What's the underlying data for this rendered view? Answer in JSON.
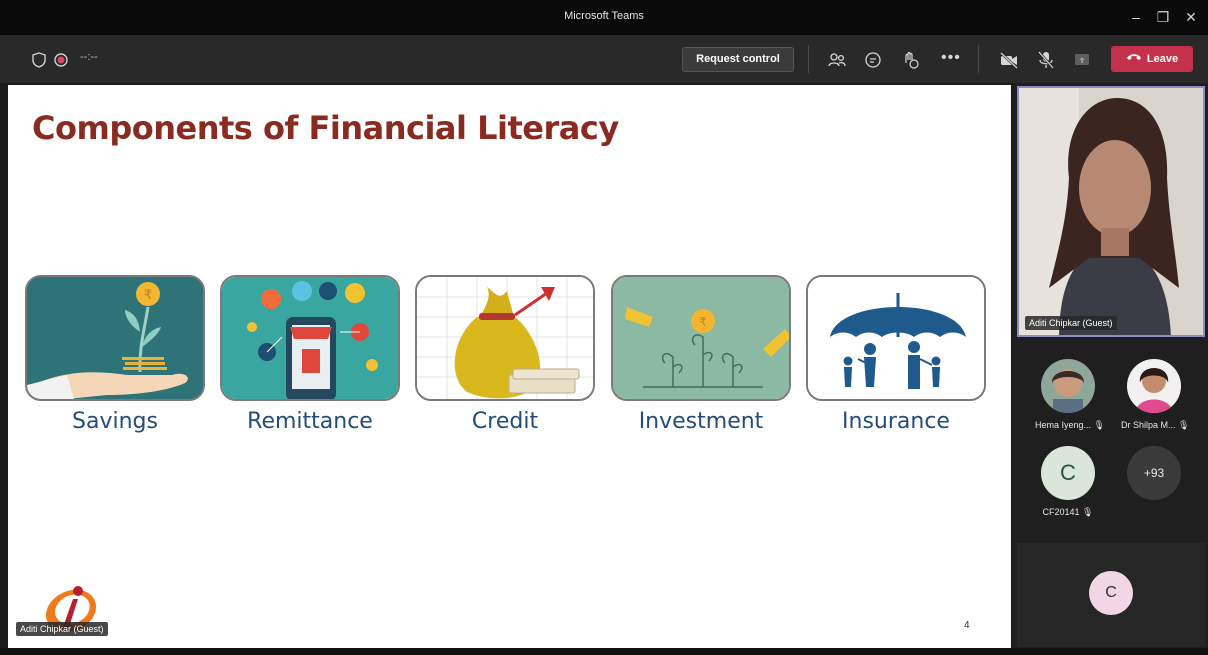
{
  "window": {
    "title": "Microsoft Teams"
  },
  "toolbar": {
    "timer": "--:--",
    "request_control": "Request control",
    "leave": "Leave"
  },
  "slide": {
    "title": "Components of Financial Literacy",
    "cards": [
      {
        "label": "Savings"
      },
      {
        "label": "Remittance"
      },
      {
        "label": "Credit"
      },
      {
        "label": "Investment"
      },
      {
        "label": "Insurance"
      }
    ],
    "page_number": "4",
    "presenter_tag": "Aditi Chipkar (Guest)"
  },
  "participants": {
    "main_video_name": "Aditi Chipkar (Guest)",
    "grid": [
      {
        "name": "Hema Iyeng...",
        "avatar": "photo"
      },
      {
        "name": "Dr Shilpa M...",
        "avatar": "photo"
      },
      {
        "name": "CF20141",
        "avatar_letter": "C"
      },
      {
        "name": "",
        "more_count": "+93"
      }
    ],
    "bottom_avatar_letter": "C"
  },
  "colors": {
    "leave": "#c4314b",
    "slide_title": "#8a2b21",
    "card_label": "#234c7a",
    "active_speaker_border": "#8b8cc7"
  }
}
